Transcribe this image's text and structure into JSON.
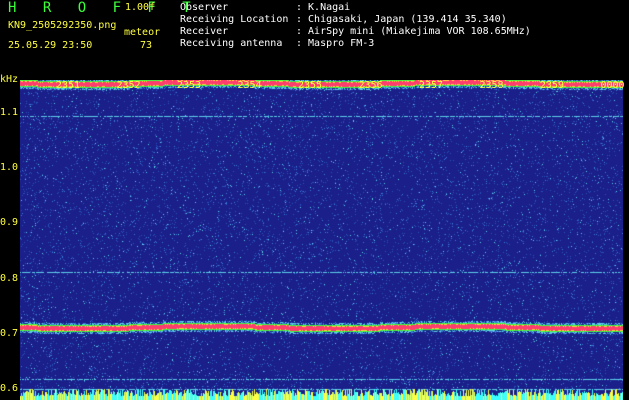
{
  "header": {
    "app_title": "H R O F F T",
    "version": "1.00f",
    "filename": "KN9_2505292350.png",
    "timestamp": "25.05.29 23:50",
    "meteor_label": "meteor",
    "meteor_count": "73"
  },
  "info": {
    "rows": [
      {
        "key": "Observer",
        "value": ": K.Nagai"
      },
      {
        "key": "Receiving Location",
        "value": ": Chigasaki, Japan (139.414 35.340)"
      },
      {
        "key": "Receiver",
        "value": ": AirSpy mini (Miakejima VOR 108.65MHz)"
      },
      {
        "key": "Receiving antenna",
        "value": ": Maspro FM-3"
      }
    ]
  },
  "time_axis": [
    "2351",
    "2352",
    "2353",
    "2354",
    "2355",
    "2356",
    "2357",
    "2358",
    "2359",
    "0000"
  ],
  "freq_axis": {
    "unit": "kHz",
    "labels": [
      "1.1",
      "1.0",
      "0.9",
      "0.8",
      "0.7",
      "0.6"
    ]
  },
  "colors": {
    "background": "#1a1f8a",
    "noise": "#3a7bd8",
    "band": "#ff3c6e",
    "band_edge": "#3cff3c",
    "label": "#ffff40"
  },
  "spectrogram": {
    "freq_range_khz": [
      0.58,
      1.16
    ],
    "strong_bands_khz": [
      1.155,
      0.712
    ],
    "weak_lines_khz": [
      1.095,
      0.812,
      0.618,
      0.6
    ]
  }
}
